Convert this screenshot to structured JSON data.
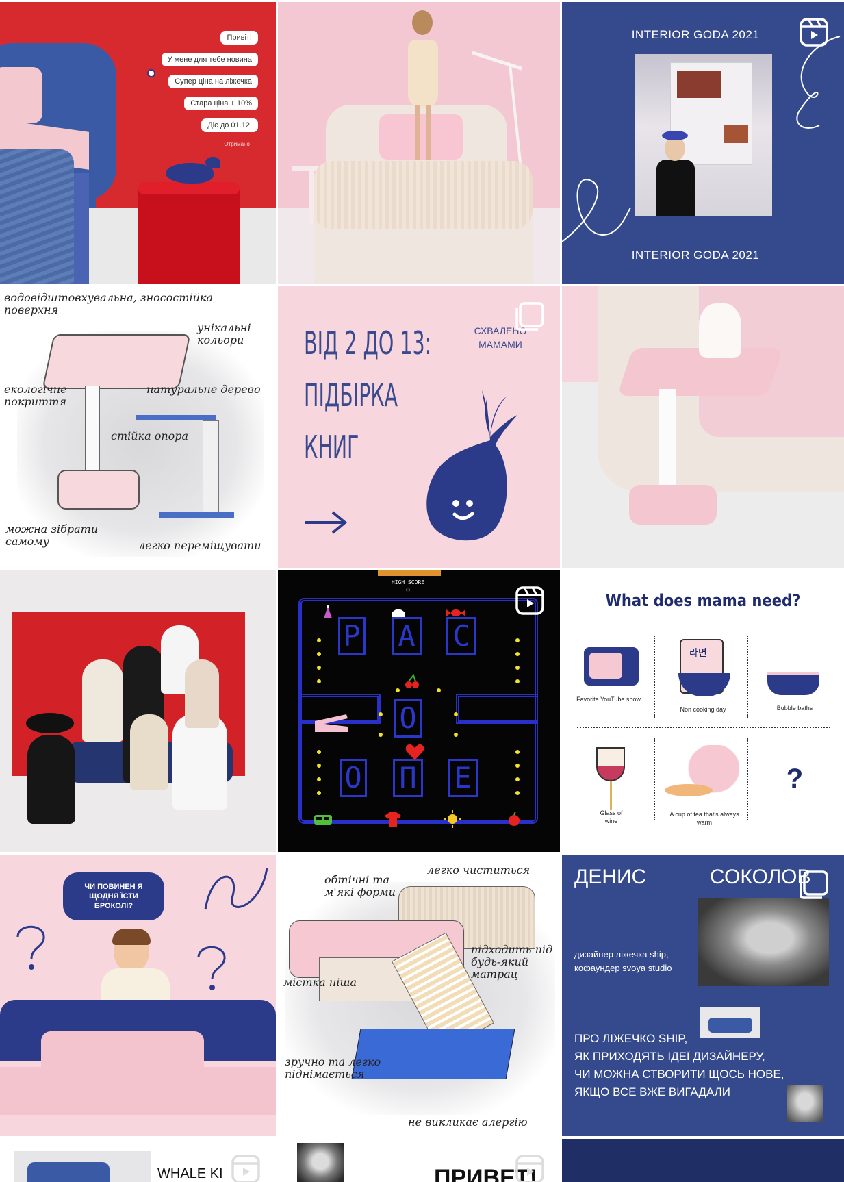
{
  "colors": {
    "navy": "#354a8c",
    "pink": "#f6cfd6",
    "red": "#d9232a",
    "black": "#050505"
  },
  "post1": {
    "messages": [
      "Привіт!",
      "У мене для тебе новина",
      "Супер ціна на ліжечка",
      "Стара ціна + 10%",
      "Діє до 01.12."
    ],
    "status": "Отримано"
  },
  "post3": {
    "title_top": "INTERIOR GODA 2021",
    "title_bottom": "INTERIOR GODA 2021",
    "badge_icon": "reels-icon"
  },
  "post4": {
    "labels": [
      "водовідштовхувальна, зносостійка поверхня",
      "унікальні кольори",
      "екологічне покриття",
      "натуральне дерево",
      "стійка опора",
      "можна зібрати самому",
      "легко переміщувати"
    ]
  },
  "post5": {
    "heading": [
      "ВІД 2 ДО 13:",
      "ПІДБІРКА",
      "КНИГ"
    ],
    "stamp": [
      "СХВАЛЕНО",
      "МАМАМИ"
    ]
  },
  "post8": {
    "score_label": "HIGH SCORE",
    "score_value": "0",
    "letters": [
      "P",
      "A",
      "C",
      "O",
      "O",
      "П",
      "E"
    ],
    "badge_icon": "reels-icon"
  },
  "post9": {
    "title": "What does mama need?",
    "items": [
      "Favorite YouTube show",
      "Non cooking day",
      "Bubble baths",
      "Glass of wine",
      "A cup of tea that's always warm",
      "?"
    ],
    "noodle_label": "라면"
  },
  "post10": {
    "question": "ЧИ ПОВИНЕН Я ЩОДНЯ ЇСТИ БРОКОЛІ?"
  },
  "post11": {
    "labels": [
      "обтічні та м'які форми",
      "легко чиститься",
      "підходить під будь-який матрац",
      "містка ніша",
      "зручно та легко піднімається",
      "не викликає алергію"
    ]
  },
  "post12": {
    "first_name": "ДЕНИС",
    "last_name": "СОКОЛОВ",
    "bio": "дизайнер ліжечка ship, кофаундер svoya studio",
    "topic_lines": [
      "ПРО ЛІЖЕЧКО SHIP,",
      "ЯК ПРИХОДЯТЬ ІДЕЇ ДИЗАЙНЕРУ,",
      "ЧИ МОЖНА СТВОРИТИ ЩОСЬ НОВЕ,",
      "ЯКЩО ВСЕ ВЖЕ ВИГАДАЛИ"
    ]
  },
  "post13": {
    "text": "WHALE KI"
  },
  "post14": {
    "text": "ПРИВЕТ!"
  }
}
